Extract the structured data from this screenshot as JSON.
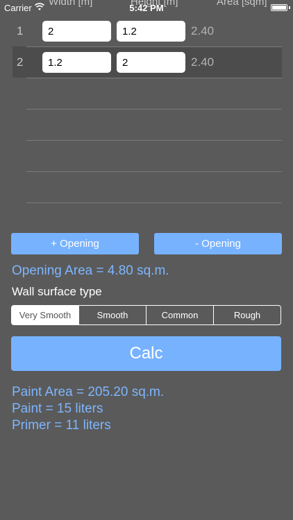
{
  "status_bar": {
    "carrier": "Carrier",
    "time": "5:42 PM"
  },
  "columns": {
    "width": "Width [m]",
    "height": "Height [m]",
    "area": "Area [sqm]"
  },
  "rows": [
    {
      "num": "1",
      "width": "2",
      "height": "1.2",
      "area": "2.40"
    },
    {
      "num": "2",
      "width": "1.2",
      "height": "2",
      "area": "2.40"
    }
  ],
  "buttons": {
    "add_opening": "+ Opening",
    "remove_opening": "- Opening",
    "calc": "Calc"
  },
  "opening_area": "Opening Area = 4.80 sq.m.",
  "wall_surface_label": "Wall surface type",
  "surface_types": [
    "Very Smooth",
    "Smooth",
    "Common",
    "Rough"
  ],
  "selected_surface": "Very Smooth",
  "results": {
    "paint_area": "Paint Area = 205.20 sq.m.",
    "paint": "Paint = 15 liters",
    "primer": "Primer = 11 liters"
  },
  "colors": {
    "accent": "#77b2ff",
    "accent_text": "#7eb6ff",
    "background": "#5a5a5a"
  }
}
